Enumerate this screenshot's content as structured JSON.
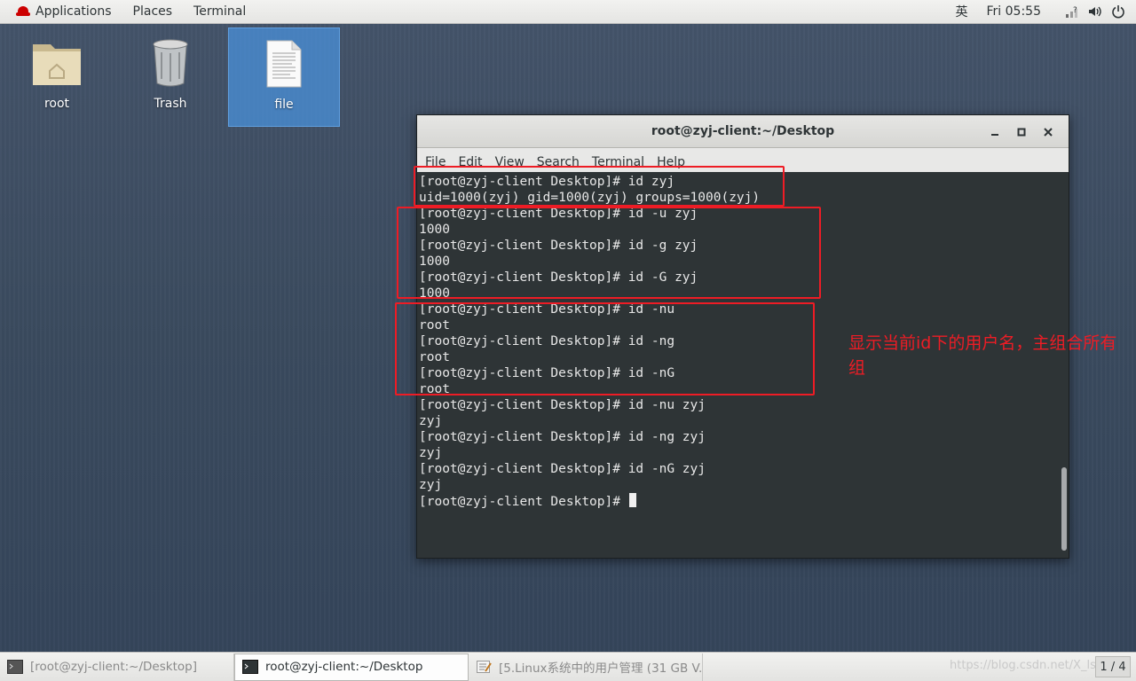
{
  "top_bar": {
    "applications": "Applications",
    "places": "Places",
    "terminal": "Terminal",
    "input_method": "英",
    "clock": "Fri 05:55"
  },
  "desktop": {
    "icons": [
      {
        "label": "root",
        "icon": "home-folder-icon"
      },
      {
        "label": "Trash",
        "icon": "trash-icon"
      },
      {
        "label": "file",
        "icon": "text-file-icon"
      }
    ]
  },
  "terminal_window": {
    "title": "root@zyj-client:~/Desktop",
    "menu": [
      "File",
      "Edit",
      "View",
      "Search",
      "Terminal",
      "Help"
    ],
    "lines": [
      "[root@zyj-client Desktop]# id zyj",
      "uid=1000(zyj) gid=1000(zyj) groups=1000(zyj)",
      "[root@zyj-client Desktop]# id -u zyj",
      "1000",
      "[root@zyj-client Desktop]# id -g zyj",
      "1000",
      "[root@zyj-client Desktop]# id -G zyj",
      "1000",
      "[root@zyj-client Desktop]# id -nu",
      "root",
      "[root@zyj-client Desktop]# id -ng",
      "root",
      "[root@zyj-client Desktop]# id -nG",
      "root",
      "[root@zyj-client Desktop]# id -nu zyj",
      "zyj",
      "[root@zyj-client Desktop]# id -ng zyj",
      "zyj",
      "[root@zyj-client Desktop]# id -nG zyj",
      "zyj"
    ],
    "prompt": "[root@zyj-client Desktop]# "
  },
  "annotation": {
    "note": "显示当前id下的用户名，主组合所有组",
    "color": "#ee1c25"
  },
  "taskbar": {
    "tasks": [
      {
        "label": "[root@zyj-client:~/Desktop]",
        "state": "inactive"
      },
      {
        "label": "root@zyj-client:~/Desktop",
        "state": "active"
      },
      {
        "label": "[5.Linux系统中的用户管理 (31 GB V...",
        "state": "inactive"
      }
    ],
    "watermark": "https://blog.csdn.net/X_lsd",
    "pager": "1 / 4"
  }
}
